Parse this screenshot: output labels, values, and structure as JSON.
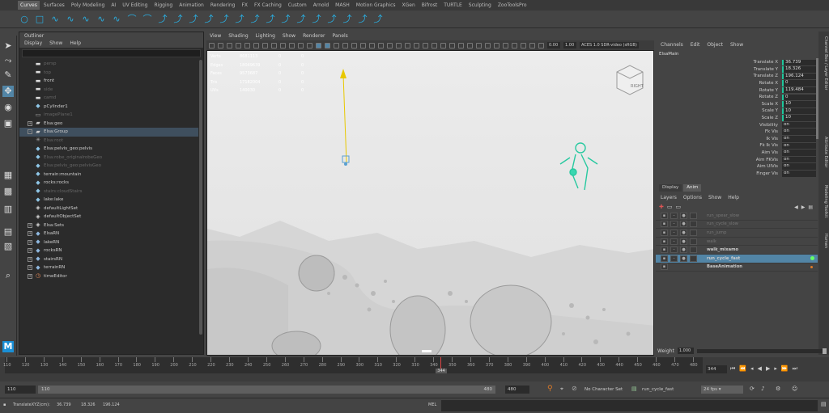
{
  "shelf": {
    "tabs": [
      "Curves",
      "Surfaces",
      "Poly Modeling",
      "AI",
      "UV Editing",
      "Rigging",
      "Animation",
      "Rendering",
      "FX",
      "FX Caching",
      "Custom",
      "Arnold",
      "MASH",
      "Motion Graphics",
      "XGen",
      "Bifrost",
      "TURTLE",
      "Sculpting",
      "ZooToolsPro"
    ],
    "active_tab": "Curves",
    "icons": [
      "circle-icon",
      "square-icon",
      "curve-icon",
      "curve-icon",
      "curve-icon",
      "curve-icon",
      "curve-icon",
      "arc-icon",
      "arc-icon",
      "curve-edit-icon",
      "curve-edit-icon",
      "curve-edit-icon",
      "curve-edit-icon",
      "curve-edit-icon",
      "curve-edit-icon",
      "curve-edit-icon",
      "curve-edit-icon",
      "curve-edit-icon",
      "curve-edit-icon",
      "curve-edit-icon",
      "curve-edit-icon",
      "curve-edit-icon",
      "curve-edit-icon",
      "curve-edit-icon"
    ]
  },
  "outliner": {
    "title": "Outliner",
    "menu": [
      "Display",
      "Show",
      "Help"
    ],
    "items": [
      {
        "label": "persp",
        "dim": true,
        "indent": 0,
        "icon": "camera"
      },
      {
        "label": "top",
        "dim": true,
        "indent": 0,
        "icon": "camera"
      },
      {
        "label": "front",
        "dim": false,
        "indent": 0,
        "icon": "camera"
      },
      {
        "label": "side",
        "dim": true,
        "indent": 0,
        "icon": "camera"
      },
      {
        "label": "camd",
        "dim": true,
        "indent": 0,
        "icon": "camera"
      },
      {
        "label": "pCylinder1",
        "dim": false,
        "indent": 0,
        "icon": "mesh"
      },
      {
        "label": "imagePlane1",
        "dim": true,
        "indent": 0,
        "icon": "image"
      },
      {
        "label": "Elsa:geo",
        "dim": false,
        "indent": 1,
        "icon": "group",
        "exp": "+"
      },
      {
        "label": "Elsa:Group",
        "dim": false,
        "indent": 1,
        "icon": "group",
        "exp": "-",
        "selected": true
      },
      {
        "label": "Elsa:root",
        "dim": true,
        "indent": 0,
        "icon": "joint"
      },
      {
        "label": "Elsa:pelvis_geo:pelvis",
        "dim": false,
        "indent": 0,
        "icon": "mesh"
      },
      {
        "label": "Elsa:robe_originalrobeGeo",
        "dim": true,
        "indent": 0,
        "icon": "mesh"
      },
      {
        "label": "Elsa:pelvis_geo:pelvisGeo",
        "dim": true,
        "indent": 0,
        "icon": "mesh"
      },
      {
        "label": "terrain:mountain",
        "dim": false,
        "indent": 0,
        "icon": "mesh"
      },
      {
        "label": "rocks:rocks",
        "dim": false,
        "indent": 0,
        "icon": "mesh"
      },
      {
        "label": "stairs:cloudStairs",
        "dim": true,
        "indent": 0,
        "icon": "mesh"
      },
      {
        "label": "lake:lake",
        "dim": false,
        "indent": 0,
        "icon": "mesh"
      },
      {
        "label": "defaultLightSet",
        "dim": false,
        "indent": 0,
        "icon": "set"
      },
      {
        "label": "defaultObjectSet",
        "dim": false,
        "indent": 0,
        "icon": "set"
      },
      {
        "label": "Elsa:Sets",
        "dim": false,
        "indent": 1,
        "icon": "set",
        "exp": "+"
      },
      {
        "label": "ElsaRN",
        "dim": false,
        "indent": 1,
        "icon": "ref",
        "exp": "+"
      },
      {
        "label": "lakeRN",
        "dim": false,
        "indent": 1,
        "icon": "ref",
        "exp": "+"
      },
      {
        "label": "rocksRN",
        "dim": false,
        "indent": 1,
        "icon": "ref",
        "exp": "+"
      },
      {
        "label": "stairsRN",
        "dim": false,
        "indent": 1,
        "icon": "ref",
        "exp": "+"
      },
      {
        "label": "terrainRN",
        "dim": false,
        "indent": 1,
        "icon": "ref",
        "exp": "+"
      },
      {
        "label": "timeEditor",
        "dim": false,
        "indent": 1,
        "icon": "time",
        "exp": "+"
      }
    ]
  },
  "viewport": {
    "menu": [
      "View",
      "Shading",
      "Lighting",
      "Show",
      "Renderer",
      "Panels"
    ],
    "exposure": "0.00",
    "gamma": "1.00",
    "colorspace": "ACES 1.0 SDR-video (sRGB)",
    "hud": [
      {
        "label": "Verts",
        "v1": "8681113",
        "v2": "0",
        "v3": "0"
      },
      {
        "label": "Edges",
        "v1": "18049639",
        "v2": "0",
        "v3": "0"
      },
      {
        "label": "Faces",
        "v1": "9573687",
        "v2": "0",
        "v3": "0"
      },
      {
        "label": "Tris",
        "v1": "17182004",
        "v2": "0",
        "v3": "0"
      },
      {
        "label": "UVs",
        "v1": "140030",
        "v2": "0",
        "v3": "0"
      }
    ],
    "viewcube_label": "RIGHT"
  },
  "channel_box": {
    "menu": [
      "Channels",
      "Edit",
      "Object",
      "Show"
    ],
    "object": "ElsaMain",
    "channels": [
      {
        "name": "Translate X",
        "value": "36.739",
        "state": "anim"
      },
      {
        "name": "Translate Y",
        "value": "18.326",
        "state": "anim"
      },
      {
        "name": "Translate Z",
        "value": "196.124",
        "state": "anim"
      },
      {
        "name": "Rotate X",
        "value": "0",
        "state": "anim"
      },
      {
        "name": "Rotate Y",
        "value": "119.484",
        "state": "anim"
      },
      {
        "name": "Rotate Z",
        "value": "0",
        "state": "anim"
      },
      {
        "name": "Scale X",
        "value": "10",
        "state": "anim"
      },
      {
        "name": "Scale Y",
        "value": "10",
        "state": "anim"
      },
      {
        "name": "Scale Z",
        "value": "10",
        "state": "anim"
      },
      {
        "name": "Visibility",
        "value": "on",
        "state": "none"
      },
      {
        "name": "Fk Vis",
        "value": "on",
        "state": "none"
      },
      {
        "name": "Ik Vis",
        "value": "on",
        "state": "none"
      },
      {
        "name": "Fk Ik Vis",
        "value": "on",
        "state": "none"
      },
      {
        "name": "Aim Vis",
        "value": "on",
        "state": "none"
      },
      {
        "name": "Aim FKVis",
        "value": "on",
        "state": "none"
      },
      {
        "name": "Aim UIVis",
        "value": "on",
        "state": "none"
      },
      {
        "name": "Finger Vis",
        "value": "on",
        "state": "none"
      }
    ]
  },
  "layer_editor": {
    "tabs": [
      "Display",
      "Anim"
    ],
    "active_tab": "Anim",
    "menu": [
      "Layers",
      "Options",
      "Show",
      "Help"
    ],
    "layers": [
      {
        "name": "run_spear_slow",
        "dim": true,
        "active": false
      },
      {
        "name": "run_cycle_slow",
        "dim": true,
        "active": false
      },
      {
        "name": "run_jump",
        "dim": true,
        "active": false
      },
      {
        "name": "walk",
        "dim": true,
        "active": false
      },
      {
        "name": "walk_mixamo",
        "dim": false,
        "active": false
      },
      {
        "name": "run_cycle_fast",
        "dim": false,
        "active": true
      },
      {
        "name": "BaseAnimation",
        "dim": false,
        "active": false,
        "base": true
      }
    ],
    "weight_label": "Weight",
    "weight_value": "1.000"
  },
  "right_tabs": [
    "Channel Box / Layer Editor",
    "Attribute Editor",
    "Modeling Toolkit",
    "Human"
  ],
  "timeline": {
    "start": 110,
    "end": 480,
    "step": 10,
    "current": "344",
    "current_field": "344"
  },
  "range": {
    "start_field": "110",
    "inner_start": "110",
    "inner_end": "480",
    "end_field": "480",
    "character_set": "No Character Set",
    "anim_layer": "run_cycle_fast",
    "fps": "24 fps"
  },
  "status": {
    "label": "TranslateXYZ(cm):",
    "x": "36.739",
    "y": "18.326",
    "z": "196.124",
    "mel": "MEL"
  },
  "colors": {
    "accent": "#5285a6",
    "shelf_icon": "#2ab0e4",
    "anim_key": "#1fc59b",
    "cursor": "#dd4444"
  }
}
